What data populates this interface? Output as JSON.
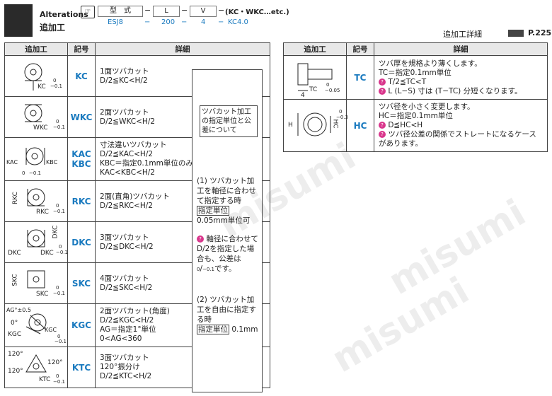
{
  "header": {
    "title_en": "Alterations",
    "title_jp": "追加工",
    "code_labels": [
      "型　式",
      "L",
      "V"
    ],
    "code_values": [
      "ESJ8",
      "200",
      "4",
      "KC4.0"
    ],
    "code_note": "(KC・WKC…etc.)",
    "ref_label": "追加工詳細",
    "ref_page": "P.225"
  },
  "left_table": {
    "headers": [
      "追加工",
      "記号",
      "詳細"
    ],
    "rows": [
      {
        "symbol": "KC",
        "detail": [
          "1面ツバカット",
          "D/2≦KC<H/2"
        ],
        "fig": [
          "KC",
          "0",
          "−0.1"
        ]
      },
      {
        "symbol": "WKC",
        "detail": [
          "2面ツバカット",
          "D/2≦WKC<H/2"
        ],
        "fig": [
          "WKC",
          "0",
          "−0.1"
        ]
      },
      {
        "symbol": "KAC\nKBC",
        "symbol1": "KAC",
        "symbol2": "KBC",
        "detail": [
          "寸法違いツバカット",
          "D/2≦KAC<H/2",
          "KBC＝指定0.1mm単位のみ",
          "KAC<KBC<H/2"
        ],
        "fig": [
          "KAC",
          "KBC",
          "0",
          "−0.1"
        ]
      },
      {
        "symbol": "RKC",
        "detail": [
          "2面(直角)ツバカット",
          "D/2≦RKC<H/2"
        ],
        "fig": [
          "RKC",
          "RKC",
          "0",
          "−0.1"
        ]
      },
      {
        "symbol": "DKC",
        "detail": [
          "3面ツバカット",
          "D/2≦DKC<H/2"
        ],
        "fig": [
          "DKC",
          "DKC",
          "DKC",
          "0",
          "−0.1"
        ]
      },
      {
        "symbol": "SKC",
        "detail": [
          "4面ツバカット",
          "D/2≦SKC<H/2"
        ],
        "fig": [
          "SKC",
          "SKC",
          "0",
          "−0.1"
        ]
      },
      {
        "symbol": "KGC",
        "detail": [
          "2面ツバカット(角度)",
          "D/2≦KGC<H/2",
          "AG＝指定1°単位",
          "0<AG<360"
        ],
        "fig": [
          "AG°±0.5",
          "0°",
          "KGC",
          "KGC",
          "0",
          "−0.1"
        ]
      },
      {
        "symbol": "KTC",
        "detail": [
          "3面ツバカット",
          "120°振分け",
          "D/2≦KTC<H/2"
        ],
        "fig": [
          "120°",
          "120°",
          "120°",
          "KTC",
          "0",
          "−0.1"
        ]
      }
    ],
    "side_note": {
      "box": "ツバカット加工の指定単位と公差について",
      "p1": "(1) ツバカット加工を軸径に合わせて指定する時",
      "p1_unit_label": "指定単位",
      "p1_unit_val": "0.05mm単位可",
      "p1_mark": "軸径に合わせてD/2を指定した場合も、公差は",
      "p1_tol0": "0",
      "p1_tol1": "−0.1",
      "p1_tail": "です。",
      "p2": "(2) ツバカット加工を自由に指定する時",
      "p2_unit_label": "指定単位",
      "p2_unit_val": "0.1mm"
    }
  },
  "right_table": {
    "headers": [
      "追加工",
      "記号",
      "詳細"
    ],
    "rows": [
      {
        "symbol": "TC",
        "detail": [
          "ツバ厚を規格より薄くします。",
          "TC＝指定0.1mm単位"
        ],
        "marks": [
          "T/2≦TC<T",
          "L (L−S) 寸は (T−TC) 分短くなります。"
        ],
        "fig": [
          "TC",
          "0",
          "−0.05",
          "4"
        ]
      },
      {
        "symbol": "HC",
        "detail": [
          "ツバ径を小さく変更します。",
          "HC＝指定0.1mm単位"
        ],
        "marks": [
          "D≦HC<H",
          "ツバ径公差の関係でストレートになるケースがあります。"
        ],
        "fig": [
          "H",
          "HC",
          "0",
          "−0.3"
        ]
      }
    ]
  },
  "watermark": "misumi",
  "colors": {
    "accent": "#1a7abf",
    "marker": "#d9368c",
    "header_bg": "#e8e8e8"
  }
}
